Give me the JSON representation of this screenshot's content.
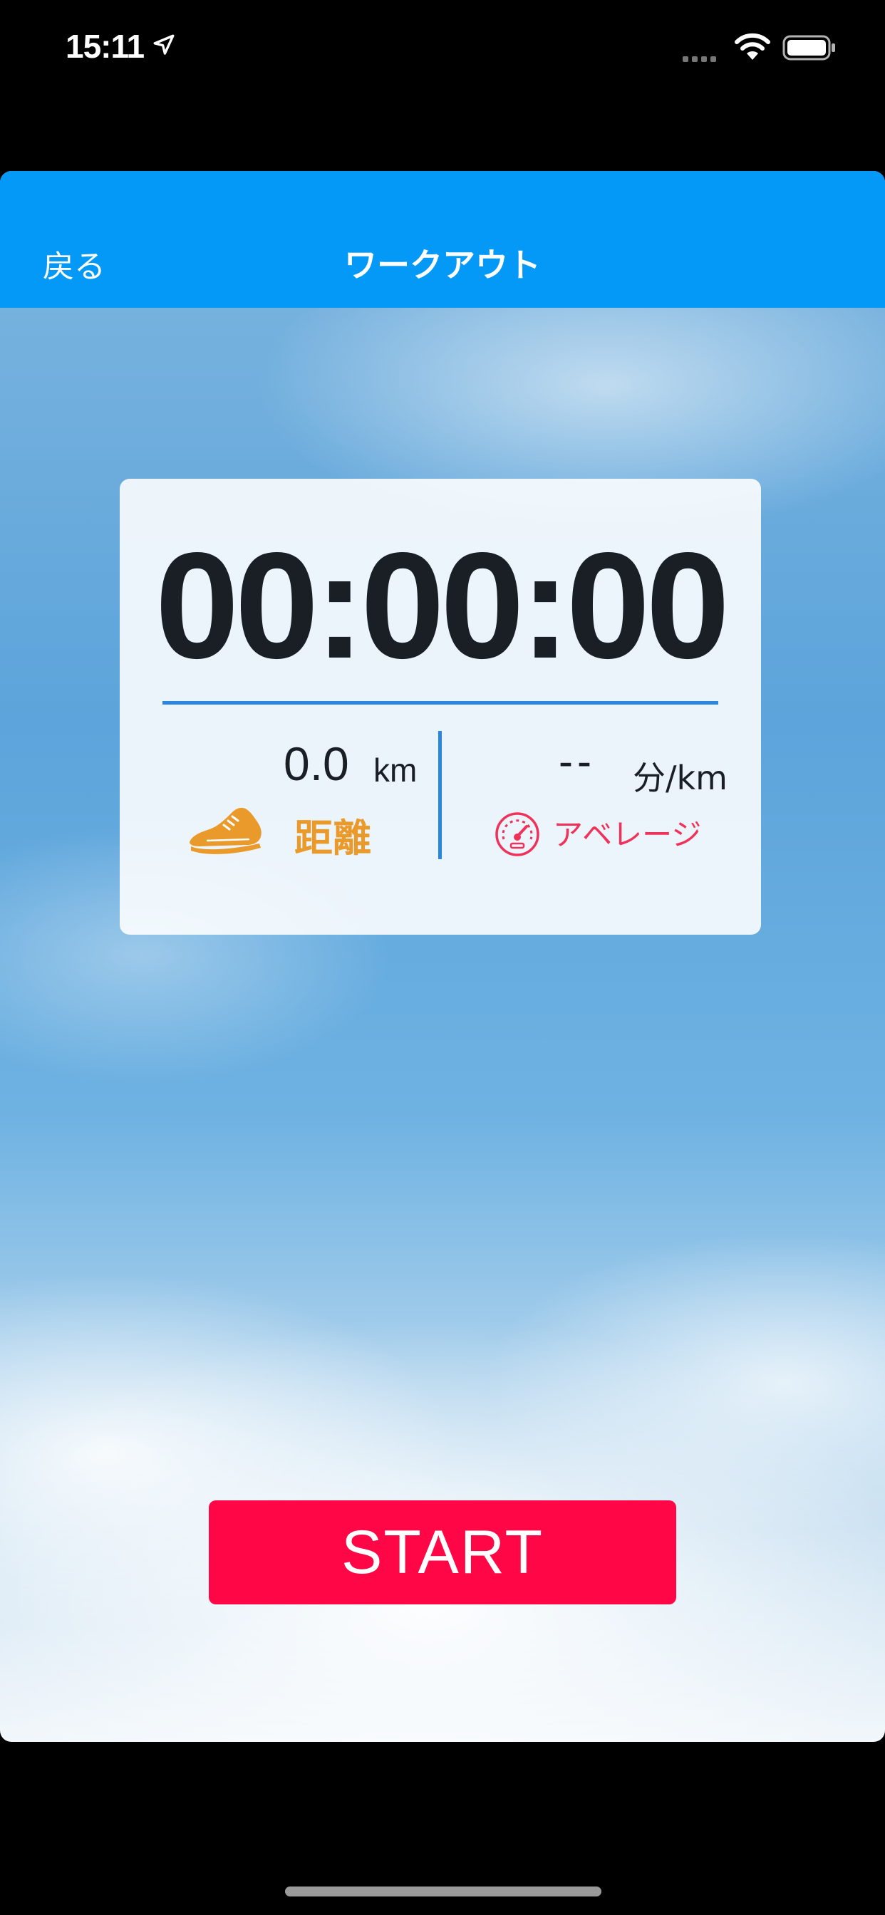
{
  "status_bar": {
    "time": "15:11",
    "icons": [
      "location-arrow-icon",
      "signal-dots-icon",
      "wifi-icon",
      "battery-icon"
    ]
  },
  "navbar": {
    "back_label": "戻る",
    "title": "ワークアウト",
    "color": "#0499f7"
  },
  "workout": {
    "timer": "00:00:00",
    "distance": {
      "value": "0.0",
      "unit": "km",
      "label": "距離",
      "icon": "running-shoe-icon",
      "color": "#e99a2b"
    },
    "pace": {
      "value": "--",
      "unit": "分/km",
      "label": "アベレージ",
      "icon": "speedometer-icon",
      "color": "#f0325a"
    }
  },
  "actions": {
    "start_label": "START",
    "start_color": "#ff0746"
  }
}
